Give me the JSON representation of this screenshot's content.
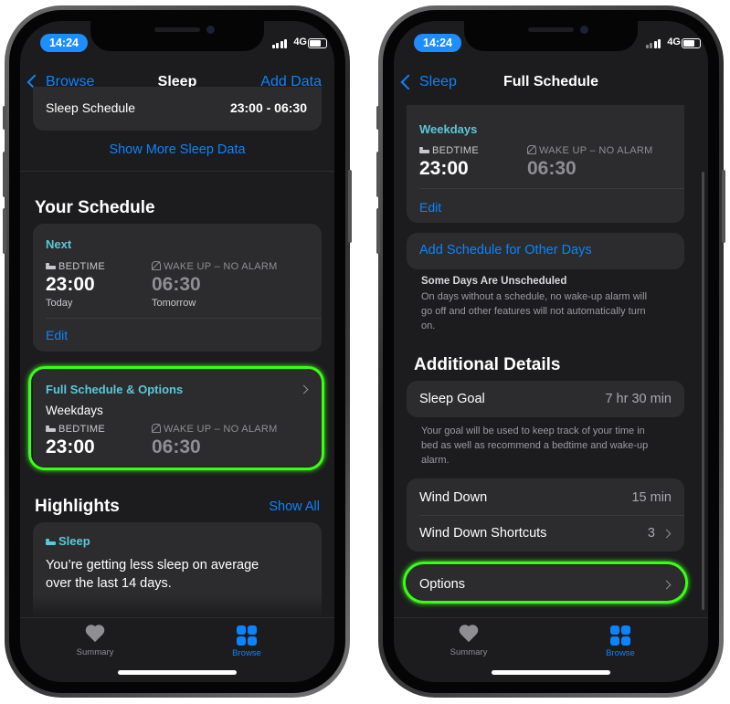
{
  "status": {
    "time": "14:24",
    "network": "4G"
  },
  "left": {
    "nav": {
      "back": "Browse",
      "title": "Sleep",
      "action": "Add Data"
    },
    "sleep_schedule_row": {
      "label": "Sleep Schedule",
      "value": "23:00 - 06:30"
    },
    "show_more": "Show More Sleep Data",
    "your_schedule": {
      "title": "Your Schedule",
      "next": {
        "label": "Next",
        "bedtime_label": "BEDTIME",
        "bedtime": "23:00",
        "bedtime_day": "Today",
        "wake_label": "WAKE UP – NO ALARM",
        "wake": "06:30",
        "wake_day": "Tomorrow",
        "edit": "Edit"
      },
      "full": {
        "label": "Full Schedule & Options",
        "days": "Weekdays",
        "bedtime_label": "BEDTIME",
        "bedtime": "23:00",
        "wake_label": "WAKE UP – NO ALARM",
        "wake": "06:30"
      }
    },
    "highlights": {
      "title": "Highlights",
      "show_all": "Show All",
      "category": "Sleep",
      "text_line1": "You’re getting less sleep on average",
      "text_line2": "over the last 14 days."
    }
  },
  "right": {
    "nav": {
      "back": "Sleep",
      "title": "Full Schedule"
    },
    "weekdays": {
      "label": "Weekdays",
      "bedtime_label": "BEDTIME",
      "bedtime": "23:00",
      "wake_label": "WAKE UP – NO ALARM",
      "wake": "06:30",
      "edit": "Edit"
    },
    "add_schedule": "Add Schedule for Other Days",
    "unscheduled": {
      "title": "Some Days Are Unscheduled",
      "line1": "On days without a schedule, no wake-up alarm will",
      "line2": "go off and other features will not automatically turn",
      "line3": "on."
    },
    "additional": {
      "title": "Additional Details",
      "sleep_goal_label": "Sleep Goal",
      "sleep_goal_value": "7 hr 30 min",
      "goal_note_line1": "Your goal will be used to keep track of your time in",
      "goal_note_line2": "bed as well as recommend a bedtime and wake-up",
      "goal_note_line3": "alarm.",
      "wind_down_label": "Wind Down",
      "wind_down_value": "15 min",
      "shortcuts_label": "Wind Down Shortcuts",
      "shortcuts_value": "3",
      "options": "Options"
    }
  },
  "tabs": {
    "summary": "Summary",
    "browse": "Browse"
  },
  "colors": {
    "accent": "#0a84ff",
    "teal": "#5ac8d8",
    "highlight": "#39ff14",
    "card": "#2c2c2e",
    "background": "#1c1c1e"
  }
}
